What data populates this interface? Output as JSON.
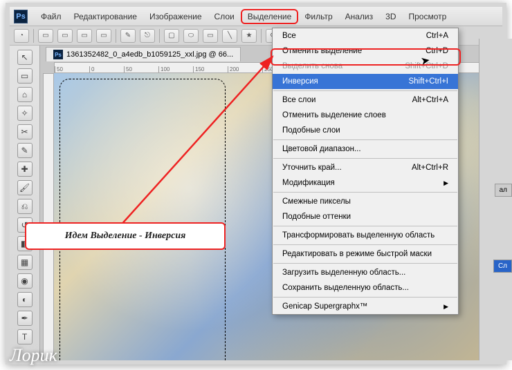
{
  "menubar": {
    "items": [
      "Файл",
      "Редактирование",
      "Изображение",
      "Слои",
      "Выделение",
      "Фильтр",
      "Анализ",
      "3D",
      "Просмотр"
    ],
    "highlighted_index": 4
  },
  "doc_tab": {
    "filename": "1361352482_0_a4edb_b1059125_xxl.jpg @ 66..."
  },
  "ruler_marks": [
    "50",
    "0",
    "50",
    "100",
    "150",
    "200",
    "250"
  ],
  "dropdown": [
    {
      "type": "item",
      "label": "Все",
      "shortcut": "Ctrl+A"
    },
    {
      "type": "item",
      "label": "Отменить выделение",
      "shortcut": "Ctrl+D"
    },
    {
      "type": "item",
      "label": "Выделить снова",
      "shortcut": "Shift+Ctrl+D",
      "disabled": true
    },
    {
      "type": "item",
      "label": "Инверсия",
      "shortcut": "Shift+Ctrl+I",
      "highlighted": true
    },
    {
      "type": "hr"
    },
    {
      "type": "item",
      "label": "Все слои",
      "shortcut": "Alt+Ctrl+A"
    },
    {
      "type": "item",
      "label": "Отменить выделение слоев"
    },
    {
      "type": "item",
      "label": "Подобные слои"
    },
    {
      "type": "hr"
    },
    {
      "type": "item",
      "label": "Цветовой диапазон..."
    },
    {
      "type": "hr"
    },
    {
      "type": "item",
      "label": "Уточнить край...",
      "shortcut": "Alt+Ctrl+R"
    },
    {
      "type": "item",
      "label": "Модификация",
      "submenu": true
    },
    {
      "type": "hr"
    },
    {
      "type": "item",
      "label": "Смежные пикселы"
    },
    {
      "type": "item",
      "label": "Подобные оттенки"
    },
    {
      "type": "hr"
    },
    {
      "type": "item",
      "label": "Трансформировать выделенную область"
    },
    {
      "type": "hr"
    },
    {
      "type": "item",
      "label": "Редактировать в режиме быстрой маски"
    },
    {
      "type": "hr"
    },
    {
      "type": "item",
      "label": "Загрузить выделенную область..."
    },
    {
      "type": "item",
      "label": "Сохранить выделенную область..."
    },
    {
      "type": "hr"
    },
    {
      "type": "item",
      "label": "Genicap Supergraphx™",
      "submenu": true
    }
  ],
  "callout_text": "Идем Выделение - Инверсия",
  "watermark": "Лорик",
  "right_panel": {
    "tab1": "ал",
    "tab2": "Сл"
  },
  "app_logo": "Ps"
}
